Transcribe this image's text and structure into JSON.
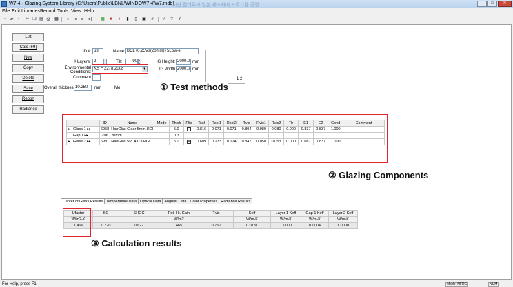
{
  "window": {
    "title": "W7.4 - Glazing System Library (C:\\Users\\Public\\LBNL\\WINDOW7.4\\W7.mdb)",
    "title_extra": "시판 컬러투과 일본 제조사에 프로그램 공정",
    "minimize": "–",
    "maximize": "□",
    "close": "✕"
  },
  "menu": [
    "File",
    "Edit",
    "Libraries",
    "Record",
    "Tools",
    "View",
    "Help"
  ],
  "toolbar": {
    "icons": [
      "new-icon",
      "open-icon",
      "save-icon",
      "cut-icon",
      "copy-icon",
      "paste-icon",
      "print-icon",
      "grid-icon",
      "first-record-icon",
      "prev-record-icon",
      "next-record-icon",
      "last-record-icon",
      "color-icon",
      "sort-icon",
      "filter-icon",
      "report-icon",
      "calc-icon",
      "table-icon",
      "info-icon",
      "help-icon"
    ]
  },
  "left_buttons": [
    "List",
    "Calc (F9)",
    "New",
    "Copy",
    "Delete",
    "Save",
    "Report",
    "Radiance"
  ],
  "form": {
    "id_label": "ID #:",
    "id_value": "63",
    "name_label": "Name:",
    "name_value": "BCL+0.25Vs(20mm)+5Low-e",
    "layers_label": "# Layers:",
    "layers_value": "2",
    "tilt_label": "Tilt:",
    "tilt_value": "90",
    "env_label": "Environmental Conditions:",
    "env_value": "KS F 2278:2008",
    "ig_height_label": "IG Height:",
    "ig_height_value": "2000.0",
    "ig_height_unit": "mm",
    "ig_width_label": "IG Width:",
    "ig_width_value": "2000.0",
    "ig_width_unit": "mm",
    "comment_label": "Comment:",
    "comment_value": "",
    "thickness_label": "Overall thickness:",
    "thickness_value": "10.250",
    "thickness_unit": "mm",
    "mode_label": "Mo"
  },
  "preview": {
    "labels": "1  2"
  },
  "annotations": {
    "a1": "① Test methods",
    "a2": "② Glazing Components",
    "a3": "③ Calculation results"
  },
  "components": {
    "headers": [
      "",
      "",
      "ID",
      "Name",
      "Mode",
      "Thick",
      "Flip",
      "Tsol",
      "Rsol1",
      "Rsol2",
      "Tvis",
      "Rvis1",
      "Rvis2",
      "Tir",
      "E1",
      "E2",
      "Cond",
      "Comment"
    ],
    "rows": [
      {
        "sel": "▸",
        "layer": "Glass 1 ▸▸",
        "id": "6958",
        "name": "HanGlas Clear 5mm.HGI",
        "mode": "",
        "thick": "5.0",
        "flip": "",
        "tsol": "0.816",
        "rsol1": "0.071",
        "rsol2": "0.071",
        "tvis": "0.894",
        "rvis1": "0.080",
        "rvis2": "0.080",
        "tir": "0.000",
        "e1": "0.837",
        "e2": "0.837",
        "cond": "1.000",
        "comment": ""
      },
      {
        "sel": "",
        "layer": "Gap 1 ▸▸",
        "id": "206",
        "name": "20mm",
        "mode": "",
        "thick": "0.3",
        "flip": "",
        "tsol": "",
        "rsol1": "",
        "rsol2": "",
        "tvis": "",
        "rvis1": "",
        "rvis2": "",
        "tir": "",
        "e1": "",
        "e2": "",
        "cond": "",
        "comment": ""
      },
      {
        "sel": "▸",
        "layer": "Glass 2 ▸▸",
        "id": "6981",
        "name": "HanGlas 5PLA113.HGI",
        "mode": "",
        "thick": "5.0",
        "flip": "✕",
        "tsol": "0.609",
        "rsol1": "0.233",
        "rsol2": "0.174",
        "tvis": "0.847",
        "rvis1": "0.050",
        "rvis2": "0.053",
        "tir": "0.000",
        "e1": "0.087",
        "e2": "0.837",
        "cond": "1.000",
        "comment": ""
      }
    ]
  },
  "tabs": [
    "Center of Glass Results",
    "Temperature Data",
    "Optical Data",
    "Angular Data",
    "Color Properties",
    "Radiance Results"
  ],
  "results": {
    "headers": [
      "Ufactor",
      "SC",
      "SHGC",
      "Rel. Ht. Gain",
      "Tvis",
      "Keff",
      "Layer 1 Keff",
      "Gap 1 Keff",
      "Layer 2 Keff"
    ],
    "units": [
      "W/m2-K",
      "",
      "",
      "W/m2",
      "",
      "W/m-K",
      "W/m-K",
      "W/m-K",
      "W/m-K"
    ],
    "values": [
      "1.466",
      "0.720",
      "0.627",
      "465",
      "0.760",
      "0.0181",
      "1.0000",
      "0.0004",
      "1.0000"
    ]
  },
  "status": {
    "help": "For Help, press F1",
    "mode": "Mode: NFRC",
    "num": "NUM"
  },
  "colors": {
    "highlight_box": "#e0242e",
    "title_bar": "#b8d1ec"
  }
}
